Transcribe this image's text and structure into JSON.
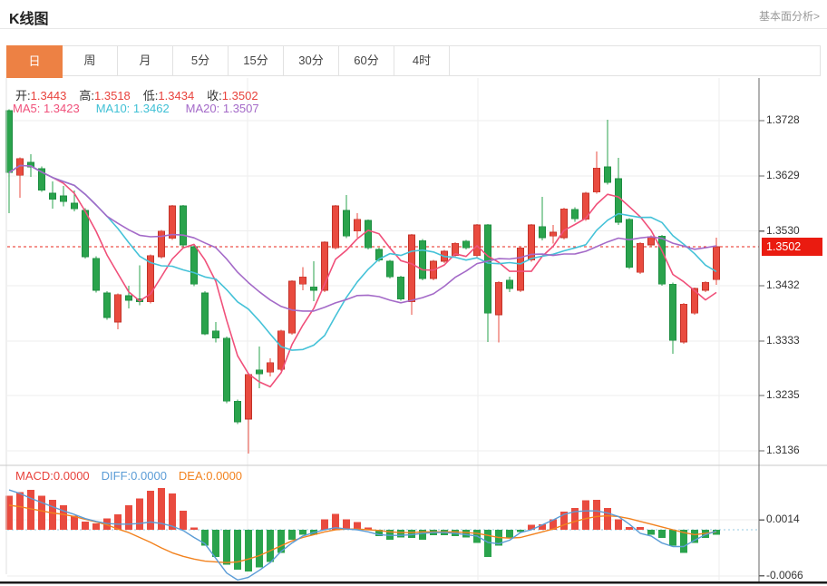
{
  "page": {
    "title": "K线图",
    "link": "基本面分析>"
  },
  "tabs": {
    "active": 0,
    "items": [
      "日",
      "周",
      "月",
      "5分",
      "15分",
      "30分",
      "60分",
      "4时"
    ]
  },
  "legend": {
    "ohlc": [
      {
        "label": "开:",
        "value": "1.3443"
      },
      {
        "label": "高:",
        "value": "1.3518"
      },
      {
        "label": "低:",
        "value": "1.3434"
      },
      {
        "label": "收:",
        "value": "1.3502"
      }
    ],
    "ma": [
      {
        "label": "MA5:",
        "value": "1.3423",
        "color": "#f0507a"
      },
      {
        "label": "MA10:",
        "value": "1.3462",
        "color": "#3fc0d5"
      },
      {
        "label": "MA20:",
        "value": "1.3507",
        "color": "#a46ac8"
      }
    ],
    "macd": [
      {
        "label": "MACD:",
        "value": "0.0000",
        "color": "#e8423c"
      },
      {
        "label": "DIFF:",
        "value": "0.0000",
        "color": "#5b9cd6"
      },
      {
        "label": "DEA:",
        "value": "0.0000",
        "color": "#f2821e"
      }
    ]
  },
  "colors": {
    "up": "#e94b3f",
    "up_stroke": "#c23228",
    "down": "#2aa34c",
    "down_stroke": "#1d8c41",
    "ma5": "#f0507a",
    "ma10": "#45c2d8",
    "ma20": "#a46ac8",
    "diff": "#5b9cd6",
    "dea": "#f2821e",
    "zero_dots": "#aad4e6",
    "last_price_line": "#e8281c",
    "price_tag_bg": "#ea1b10",
    "tab_active_bg": "#ed8144",
    "grid": "#ededed",
    "axis": "#666666"
  },
  "chart_data": {
    "type": "candlestick+macd",
    "title": "K线图",
    "legend_position": "top-left",
    "grid": true,
    "price_axis": {
      "tick_labels": [
        "1.3728",
        "1.3629",
        "1.3530",
        "1.3432",
        "1.3333",
        "1.3235",
        "1.3136"
      ],
      "ticks": [
        1.3728,
        1.3629,
        1.353,
        1.3432,
        1.3333,
        1.3235,
        1.3136
      ],
      "ylim": [
        1.3089,
        1.3805
      ],
      "last_price": 1.3502,
      "last_price_label": "1.3502"
    },
    "macd_axis": {
      "tick_labels": [
        "0.0014",
        "-0.0066"
      ],
      "ticks": [
        0.0014,
        -0.0066
      ],
      "ylim": [
        -0.0078,
        0.0094
      ]
    },
    "ma_periods": [
      5,
      10,
      20
    ],
    "candles_format": [
      "open",
      "high",
      "low",
      "close"
    ],
    "candles": [
      [
        1.3746,
        1.3748,
        1.3562,
        1.3635
      ],
      [
        1.363,
        1.3662,
        1.359,
        1.366
      ],
      [
        1.3653,
        1.3668,
        1.3627,
        1.3645
      ],
      [
        1.3642,
        1.3646,
        1.36,
        1.3603
      ],
      [
        1.3598,
        1.3619,
        1.357,
        1.3587
      ],
      [
        1.3593,
        1.3611,
        1.3574,
        1.3583
      ],
      [
        1.358,
        1.3603,
        1.3565,
        1.357
      ],
      [
        1.3567,
        1.3571,
        1.3481,
        1.3484
      ],
      [
        1.3481,
        1.3485,
        1.342,
        1.3424
      ],
      [
        1.3419,
        1.3422,
        1.3371,
        1.3375
      ],
      [
        1.3367,
        1.3418,
        1.3354,
        1.3416
      ],
      [
        1.3414,
        1.3432,
        1.3391,
        1.3406
      ],
      [
        1.3409,
        1.3469,
        1.3397,
        1.3403
      ],
      [
        1.3403,
        1.3488,
        1.34,
        1.3486
      ],
      [
        1.3484,
        1.3532,
        1.3481,
        1.353
      ],
      [
        1.3517,
        1.3577,
        1.3514,
        1.3575
      ],
      [
        1.3575,
        1.3577,
        1.3501,
        1.3505
      ],
      [
        1.3502,
        1.3506,
        1.3431,
        1.3435
      ],
      [
        1.3419,
        1.3422,
        1.3343,
        1.3346
      ],
      [
        1.3351,
        1.3367,
        1.333,
        1.3338
      ],
      [
        1.3338,
        1.3341,
        1.3221,
        1.3225
      ],
      [
        1.3225,
        1.3228,
        1.3184,
        1.3188
      ],
      [
        1.3193,
        1.3275,
        1.3131,
        1.3273
      ],
      [
        1.3281,
        1.3323,
        1.3248,
        1.3274
      ],
      [
        1.3277,
        1.3302,
        1.3269,
        1.3294
      ],
      [
        1.3282,
        1.3353,
        1.3279,
        1.3351
      ],
      [
        1.3347,
        1.3442,
        1.3344,
        1.344
      ],
      [
        1.3435,
        1.3465,
        1.3424,
        1.3448
      ],
      [
        1.343,
        1.3476,
        1.3404,
        1.3424
      ],
      [
        1.3424,
        1.3512,
        1.3421,
        1.351
      ],
      [
        1.35,
        1.3577,
        1.3497,
        1.3575
      ],
      [
        1.3567,
        1.3595,
        1.3517,
        1.3521
      ],
      [
        1.353,
        1.3562,
        1.3518,
        1.3551
      ],
      [
        1.3549,
        1.3551,
        1.3497,
        1.35
      ],
      [
        1.3497,
        1.35,
        1.3475,
        1.3478
      ],
      [
        1.3476,
        1.3478,
        1.3445,
        1.3448
      ],
      [
        1.3448,
        1.345,
        1.3405,
        1.3408
      ],
      [
        1.3403,
        1.3525,
        1.338,
        1.3523
      ],
      [
        1.3513,
        1.3516,
        1.3442,
        1.3445
      ],
      [
        1.3445,
        1.3478,
        1.3442,
        1.3476
      ],
      [
        1.3476,
        1.3496,
        1.3473,
        1.3494
      ],
      [
        1.3486,
        1.351,
        1.3483,
        1.3508
      ],
      [
        1.3512,
        1.3514,
        1.3497,
        1.35
      ],
      [
        1.3486,
        1.3543,
        1.3483,
        1.3541
      ],
      [
        1.3541,
        1.3543,
        1.3331,
        1.3383
      ],
      [
        1.338,
        1.344,
        1.333,
        1.3438
      ],
      [
        1.3442,
        1.3448,
        1.3421,
        1.3427
      ],
      [
        1.3424,
        1.3502,
        1.3421,
        1.35
      ],
      [
        1.3478,
        1.3543,
        1.3475,
        1.3541
      ],
      [
        1.3538,
        1.3591,
        1.3513,
        1.3518
      ],
      [
        1.3521,
        1.3541,
        1.3508,
        1.3528
      ],
      [
        1.3518,
        1.3572,
        1.3515,
        1.357
      ],
      [
        1.3569,
        1.3573,
        1.3547,
        1.3552
      ],
      [
        1.3551,
        1.36,
        1.3548,
        1.3598
      ],
      [
        1.36,
        1.3673,
        1.3597,
        1.3643
      ],
      [
        1.3645,
        1.373,
        1.3613,
        1.3617
      ],
      [
        1.3624,
        1.3661,
        1.3541,
        1.3546
      ],
      [
        1.3551,
        1.3553,
        1.3462,
        1.3465
      ],
      [
        1.3456,
        1.351,
        1.3453,
        1.3508
      ],
      [
        1.3505,
        1.3522,
        1.3502,
        1.352
      ],
      [
        1.3521,
        1.3523,
        1.3432,
        1.3435
      ],
      [
        1.3435,
        1.3438,
        1.331,
        1.3334
      ],
      [
        1.3331,
        1.3401,
        1.3328,
        1.3399
      ],
      [
        1.3383,
        1.3429,
        1.338,
        1.3427
      ],
      [
        1.3424,
        1.344,
        1.3421,
        1.3438
      ],
      [
        1.3443,
        1.3518,
        1.3434,
        1.3502
      ]
    ],
    "macd": {
      "hist": [
        0.0049,
        0.0054,
        0.0057,
        0.0049,
        0.0043,
        0.0035,
        0.002,
        0.0012,
        0.0009,
        0.0016,
        0.0022,
        0.0035,
        0.0045,
        0.0056,
        0.006,
        0.0052,
        0.0027,
        0.0003,
        -0.0023,
        -0.0039,
        -0.005,
        -0.0057,
        -0.006,
        -0.0054,
        -0.0046,
        -0.0033,
        -0.0014,
        -0.0007,
        -0.0007,
        0.0015,
        0.0023,
        0.0015,
        0.0011,
        0.0003,
        -0.0009,
        -0.0014,
        -0.0011,
        -0.0012,
        -0.0014,
        -0.0008,
        -0.0008,
        -0.0009,
        -0.0011,
        -0.0019,
        -0.0039,
        -0.0023,
        -0.0012,
        -0.0003,
        0.0007,
        0.0008,
        0.0015,
        0.0026,
        0.0031,
        0.0042,
        0.0043,
        0.0031,
        0.0015,
        0.0004,
        0.0004,
        -0.0007,
        -0.0012,
        -0.0023,
        -0.0033,
        -0.0019,
        -0.0012,
        -0.0007
      ],
      "diff": [
        0.0057,
        0.0052,
        0.0045,
        0.0039,
        0.0033,
        0.0027,
        0.0022,
        0.0016,
        0.0012,
        0.0009,
        0.0008,
        0.0008,
        0.0009,
        0.0011,
        0.0009,
        0.0005,
        -0.0001,
        -0.0011,
        -0.002,
        -0.0041,
        -0.0062,
        -0.0072,
        -0.0068,
        -0.0058,
        -0.0047,
        -0.0031,
        -0.0019,
        -0.0009,
        -0.0004,
        0.0,
        0.0003,
        0.0001,
        0.0,
        -0.0003,
        -0.0007,
        -0.0008,
        -0.0008,
        -0.0007,
        -0.0005,
        -0.0004,
        -0.0004,
        -0.0005,
        -0.0007,
        -0.0009,
        -0.0018,
        -0.002,
        -0.0015,
        -0.0004,
        0.0,
        0.0007,
        0.0014,
        0.0022,
        0.0026,
        0.0027,
        0.0027,
        0.0024,
        0.0019,
        0.0008,
        -0.0005,
        -0.0009,
        -0.0019,
        -0.0024,
        -0.0024,
        -0.0015,
        -0.0007,
        -0.0002
      ],
      "dea": [
        0.0035,
        0.0033,
        0.003,
        0.0027,
        0.0024,
        0.0022,
        0.0019,
        0.0015,
        0.0011,
        0.0007,
        0.0001,
        -0.0004,
        -0.0011,
        -0.0018,
        -0.0026,
        -0.0033,
        -0.0038,
        -0.0042,
        -0.0045,
        -0.0046,
        -0.0047,
        -0.0046,
        -0.0042,
        -0.0037,
        -0.003,
        -0.0023,
        -0.0016,
        -0.0011,
        -0.0007,
        -0.0003,
        0.0,
        0.0001,
        0.0001,
        0.0,
        -0.0001,
        -0.0003,
        -0.0004,
        -0.0004,
        -0.0003,
        -0.0003,
        -0.0003,
        -0.0003,
        -0.0004,
        -0.0005,
        -0.0008,
        -0.0011,
        -0.0012,
        -0.0011,
        -0.0007,
        -0.0003,
        0.0001,
        0.0007,
        0.0012,
        0.0016,
        0.0019,
        0.002,
        0.0019,
        0.0016,
        0.0012,
        0.0008,
        0.0004,
        0.0,
        -0.0004,
        -0.0007,
        -0.0005,
        -0.0003
      ]
    }
  }
}
